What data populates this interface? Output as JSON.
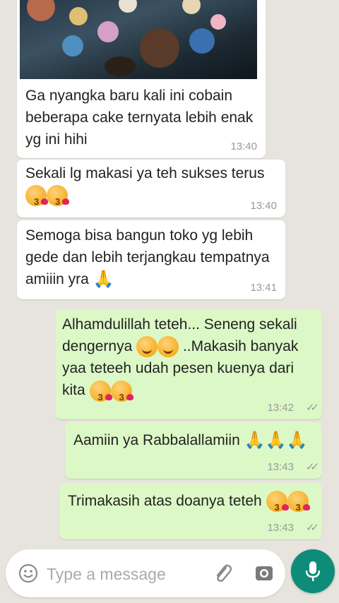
{
  "messages": [
    {
      "direction": "incoming",
      "has_image": true,
      "text": "Ga nyangka baru kali ini cobain beberapa cake ternyata lebih enak yg ini hihi",
      "time": "13:40"
    },
    {
      "direction": "incoming",
      "text": "Sekali lg makasi ya teh sukses terus",
      "emojis": [
        "face-blowing-kiss",
        "face-blowing-kiss"
      ],
      "time": "13:40"
    },
    {
      "direction": "incoming",
      "text": "Semoga bisa bangun toko yg lebih gede dan lebih terjangkau tempatnya amiiin yra",
      "emojis": [
        "folded-hands"
      ],
      "time": "13:41"
    },
    {
      "direction": "outgoing",
      "text_part1": "Alhamdulillah teteh... Seneng sekali dengernya",
      "text_part2": "..Makasih banyak yaa teteeh udah pesen kuenya dari kita",
      "emojis_mid": [
        "smiling-face",
        "smiling-face"
      ],
      "emojis": [
        "face-blowing-kiss",
        "face-blowing-kiss"
      ],
      "time": "13:42",
      "status": "delivered"
    },
    {
      "direction": "outgoing",
      "text": "Aamiin ya Rabbalallamiin",
      "emojis": [
        "folded-hands",
        "folded-hands",
        "folded-hands"
      ],
      "time": "13:43",
      "status": "delivered"
    },
    {
      "direction": "outgoing",
      "text": "Trimakasih atas doanya teteh",
      "emojis": [
        "face-blowing-kiss",
        "face-blowing-kiss"
      ],
      "time": "13:43",
      "status": "delivered"
    }
  ],
  "input": {
    "placeholder": "Type a message",
    "icons": [
      "emoji-icon",
      "paperclip-icon",
      "camera-icon",
      "microphone-icon"
    ]
  },
  "colors": {
    "background": "#e7e4de",
    "incoming_bubble": "#ffffff",
    "outgoing_bubble": "#dcf8c6",
    "mic_button": "#0e8c7a"
  }
}
